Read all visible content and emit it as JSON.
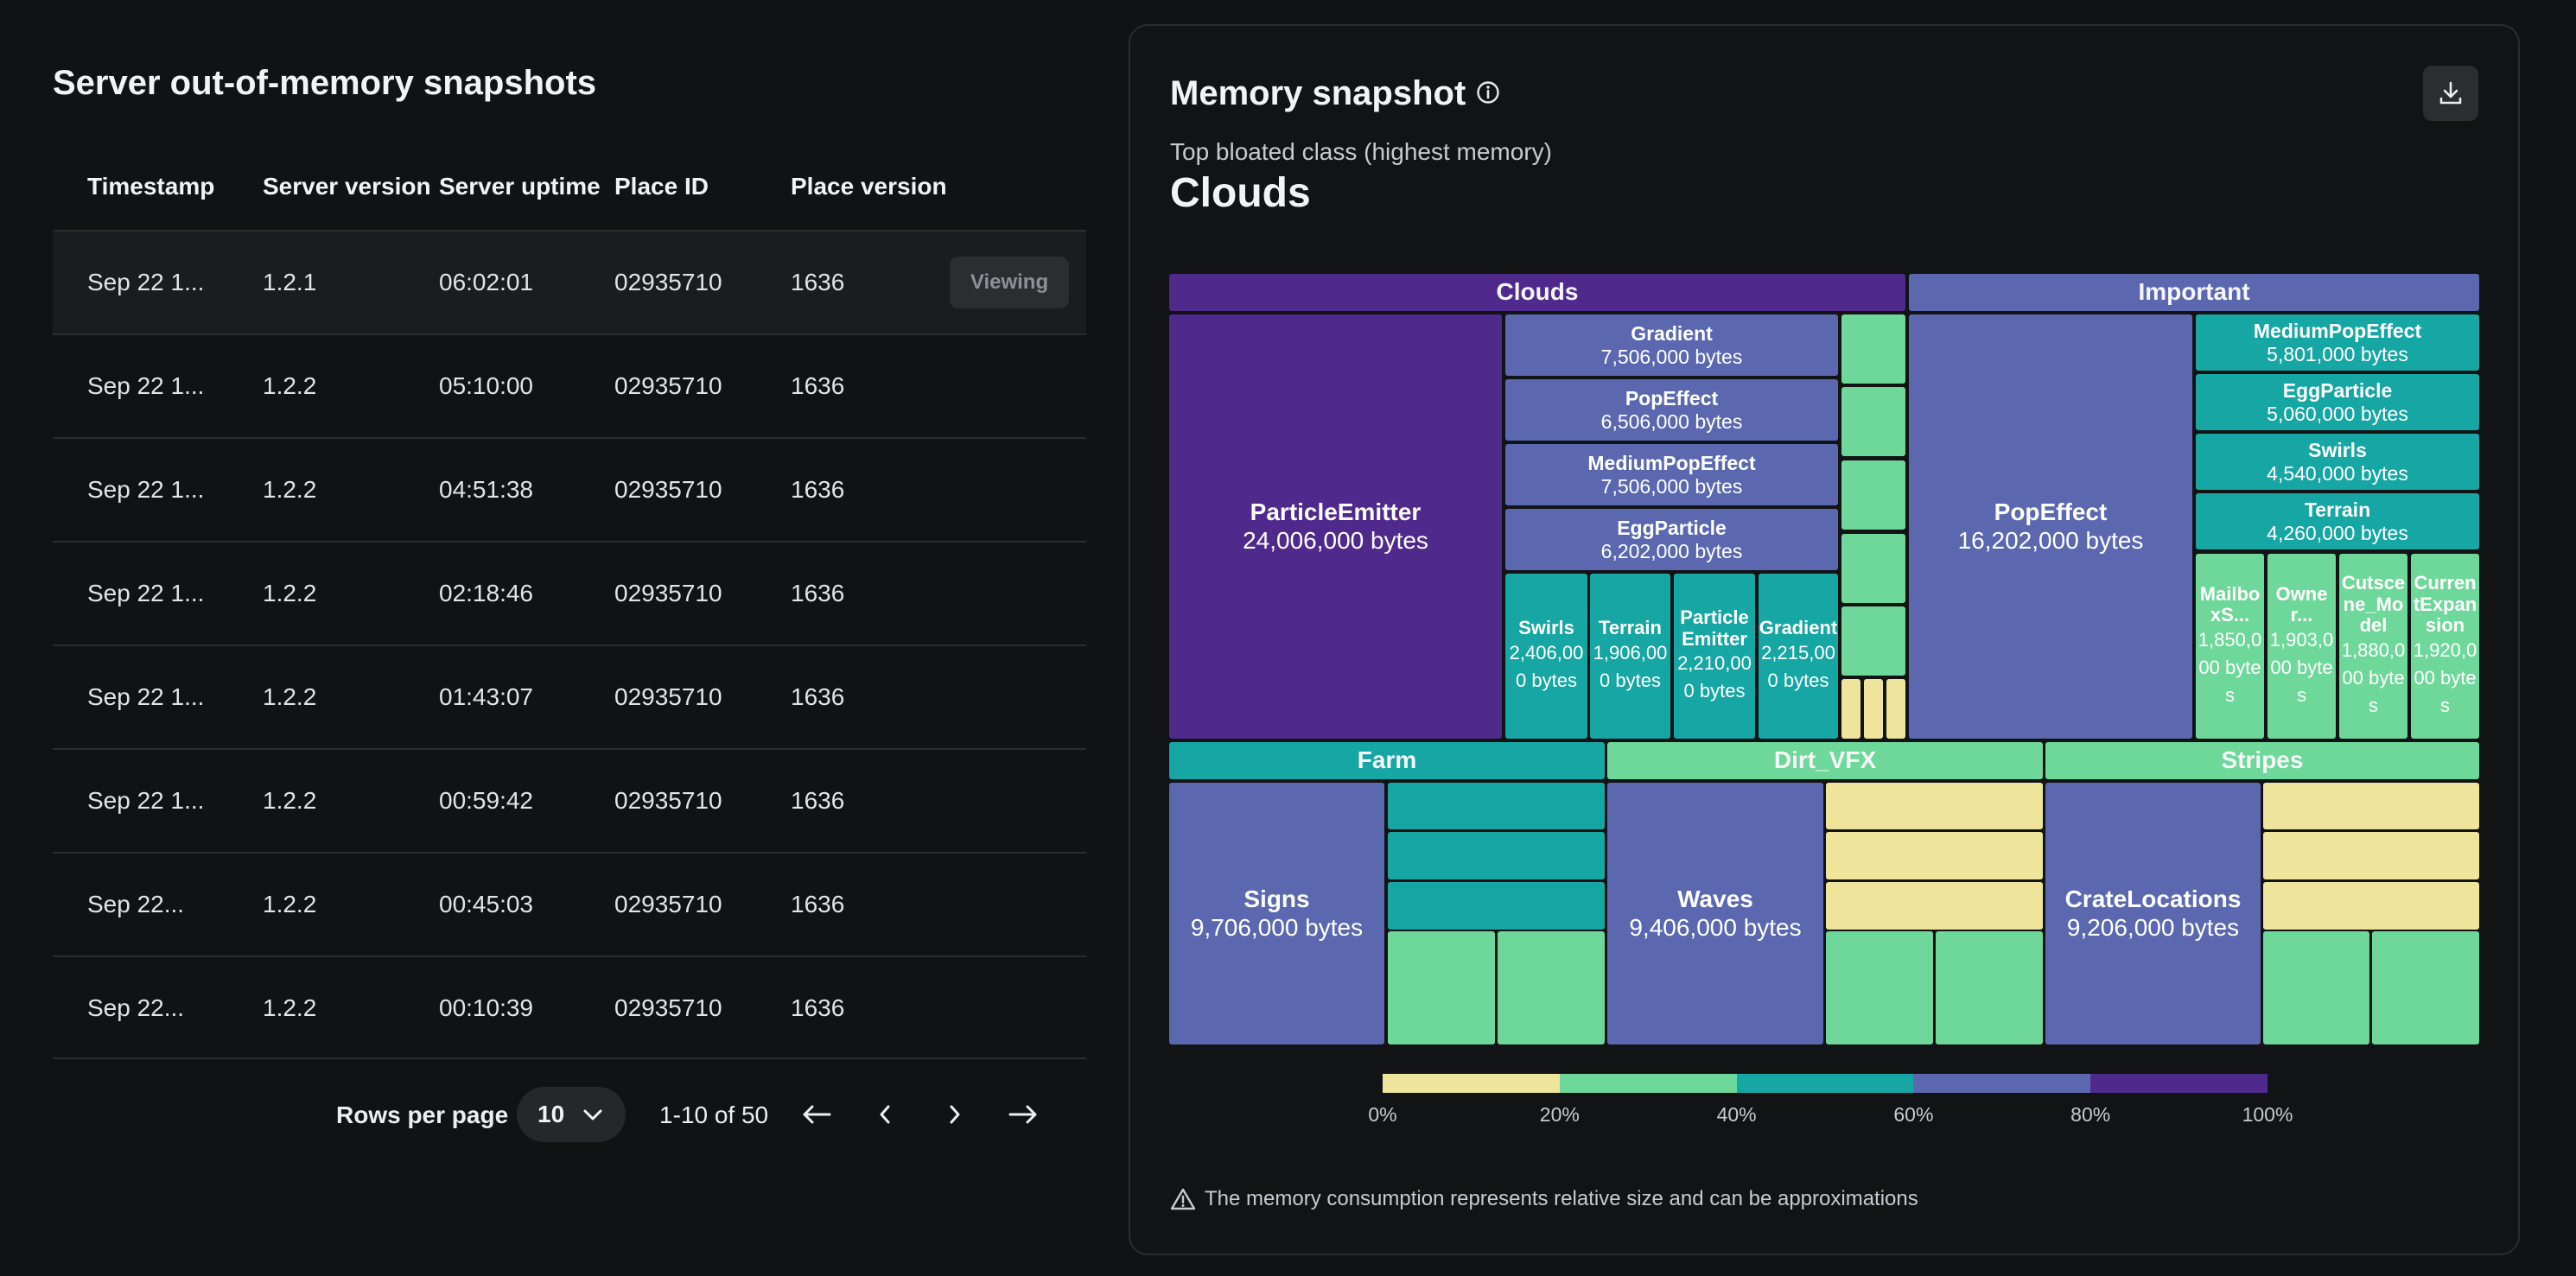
{
  "left": {
    "title": "Server out-of-memory snapshots",
    "columns": [
      "Timestamp",
      "Server version",
      "Server uptime",
      "Place ID",
      "Place version"
    ],
    "rows": [
      {
        "timestamp": "Sep 22 1...",
        "version": "1.2.1",
        "uptime": "06:02:01",
        "place_id": "02935710",
        "place_version": "1636",
        "selected": true,
        "action": "Viewing"
      },
      {
        "timestamp": "Sep 22 1...",
        "version": "1.2.2",
        "uptime": "05:10:00",
        "place_id": "02935710",
        "place_version": "1636"
      },
      {
        "timestamp": "Sep 22 1...",
        "version": "1.2.2",
        "uptime": "04:51:38",
        "place_id": "02935710",
        "place_version": "1636"
      },
      {
        "timestamp": "Sep 22 1...",
        "version": "1.2.2",
        "uptime": "02:18:46",
        "place_id": "02935710",
        "place_version": "1636"
      },
      {
        "timestamp": "Sep 22 1...",
        "version": "1.2.2",
        "uptime": "01:43:07",
        "place_id": "02935710",
        "place_version": "1636"
      },
      {
        "timestamp": "Sep 22 1...",
        "version": "1.2.2",
        "uptime": "00:59:42",
        "place_id": "02935710",
        "place_version": "1636"
      },
      {
        "timestamp": "Sep 22...",
        "version": "1.2.2",
        "uptime": "00:45:03",
        "place_id": "02935710",
        "place_version": "1636"
      },
      {
        "timestamp": "Sep 22...",
        "version": "1.2.2",
        "uptime": "00:10:39",
        "place_id": "02935710",
        "place_version": "1636"
      }
    ],
    "pagination": {
      "rows_per_page_label": "Rows per page",
      "rows_per_page_value": "10",
      "range": "1-10 of 50"
    }
  },
  "right": {
    "title": "Memory snapshot",
    "subtitle": "Top bloated class (highest memory)",
    "top_class": "Clouds",
    "note": "The memory consumption represents relative size and can be approximations",
    "legend": {
      "colors": [
        "#efe49b",
        "#6ed79a",
        "#16a6a3",
        "#5b68b0",
        "#4f2a8c"
      ],
      "labels": [
        "0%",
        "20%",
        "40%",
        "60%",
        "80%",
        "100%"
      ]
    },
    "treemap": {
      "groups": [
        {
          "name": "Clouds",
          "header_color": "#4f2a8c"
        },
        {
          "name": "Important",
          "header_color": "#5b68b0"
        },
        {
          "name": "Farm",
          "header_color": "#16a6a3"
        },
        {
          "name": "Dirt_VFX",
          "header_color": "#6ed79a"
        },
        {
          "name": "Stripes",
          "header_color": "#6ed79a"
        }
      ],
      "items": [
        {
          "name": "ParticleEmitter",
          "bytes": "24,006,000 bytes",
          "color": "#4f2a8c"
        },
        {
          "name": "Gradient",
          "bytes": "7,506,000 bytes",
          "color": "#5b68b0"
        },
        {
          "name": "PopEffect",
          "bytes": "6,506,000 bytes",
          "color": "#5b68b0"
        },
        {
          "name": "MediumPopEffect",
          "bytes": "7,506,000 bytes",
          "color": "#5b68b0"
        },
        {
          "name": "EggParticle",
          "bytes": "6,202,000 bytes",
          "color": "#5b68b0"
        },
        {
          "name": "Swirls",
          "bytes": "2,406,000 bytes",
          "color": "#16a6a3"
        },
        {
          "name": "Terrain",
          "bytes": "1,906,000 bytes",
          "color": "#16a6a3"
        },
        {
          "name": "ParticleEmitter",
          "bytes": "2,210,000 bytes",
          "color": "#16a6a3"
        },
        {
          "name": "Gradient",
          "bytes": "2,215,000 bytes",
          "color": "#16a6a3"
        },
        {
          "name": "PopEffect",
          "bytes": "16,202,000 bytes",
          "color": "#5b68b0"
        },
        {
          "name": "MediumPopEffect",
          "bytes": "5,801,000 bytes",
          "color": "#16a6a3"
        },
        {
          "name": "EggParticle",
          "bytes": "5,060,000 bytes",
          "color": "#16a6a3"
        },
        {
          "name": "Swirls",
          "bytes": "4,540,000 bytes",
          "color": "#16a6a3"
        },
        {
          "name": "Terrain",
          "bytes": "4,260,000 bytes",
          "color": "#16a6a3"
        },
        {
          "name": "MailboxS...",
          "bytes": "1,850,000 bytes",
          "color": "#6ed79a"
        },
        {
          "name": "Owner...",
          "bytes": "1,903,000 bytes",
          "color": "#6ed79a"
        },
        {
          "name": "Cutscene_Model",
          "bytes": "1,880,000 bytes",
          "color": "#6ed79a"
        },
        {
          "name": "CurrentExpansion",
          "bytes": "1,920,000 bytes",
          "color": "#6ed79a"
        },
        {
          "name": "Signs",
          "bytes": "9,706,000 bytes",
          "color": "#5b68b0"
        },
        {
          "name": "Waves",
          "bytes": "9,406,000 bytes",
          "color": "#5b68b0"
        },
        {
          "name": "CrateLocations",
          "bytes": "9,206,000 bytes",
          "color": "#5b68b0"
        }
      ]
    }
  }
}
